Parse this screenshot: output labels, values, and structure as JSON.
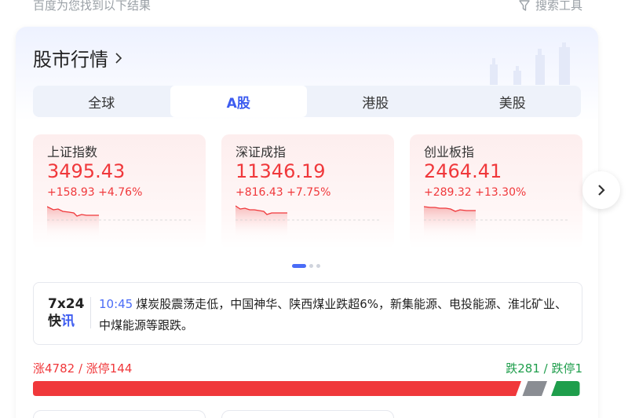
{
  "topbar": {
    "hint": "百度为您找到以下结果",
    "tools_label": "搜索工具"
  },
  "card": {
    "title": "股市行情"
  },
  "tabs": [
    {
      "label": "全球",
      "active": false
    },
    {
      "label": "A股",
      "active": true
    },
    {
      "label": "港股",
      "active": false
    },
    {
      "label": "美股",
      "active": false
    }
  ],
  "indices": [
    {
      "name": "上证指数",
      "value": "3495.43",
      "change": "+158.93",
      "pct": "+4.76%"
    },
    {
      "name": "深证成指",
      "value": "11346.19",
      "change": "+816.43",
      "pct": "+7.75%"
    },
    {
      "name": "创业板指",
      "value": "2464.41",
      "change": "+289.32",
      "pct": "+13.30%"
    }
  ],
  "pager": {
    "pages": 3,
    "current": 0
  },
  "news": {
    "logo_line1": "7x24",
    "logo_line2_a": "快",
    "logo_line2_b": "讯",
    "time": "10:45",
    "text": "煤炭股震荡走低，中国神华、陕西煤业跌超6%，新集能源、电投能源、淮北矿业、中煤能源等跟跌。"
  },
  "breadth": {
    "up_text": "涨4782 / 涨停144",
    "down_text": "跌281 / 跌停1",
    "up_count": 4782,
    "flat_share": 0.045,
    "down_count": 281
  },
  "colors": {
    "accent": "#3d5cf0",
    "up": "#f0383b",
    "down": "#1f9e4c",
    "flat": "#8a8d93"
  }
}
